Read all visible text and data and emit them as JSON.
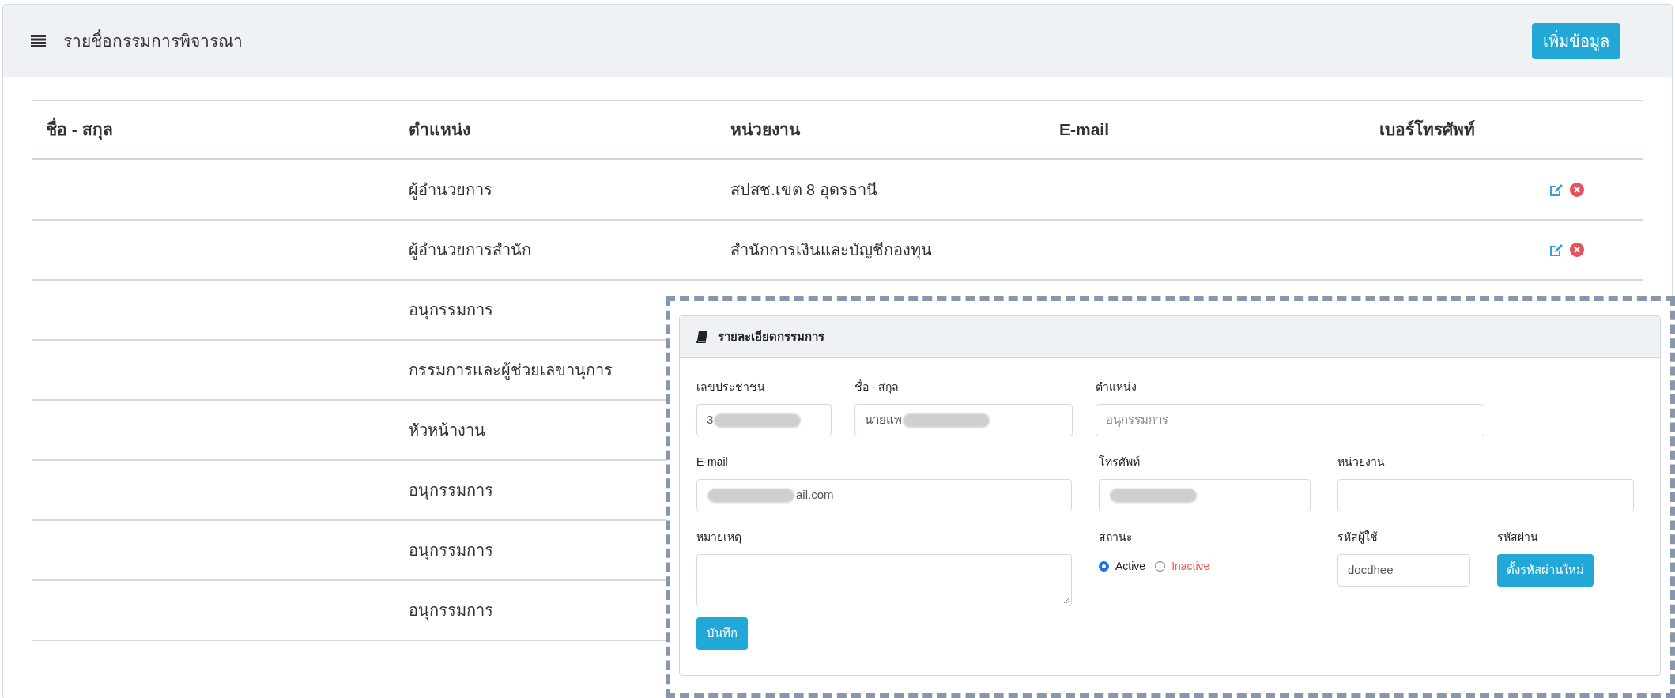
{
  "panel": {
    "title": "รายชื่อกรรมการพิจารณา",
    "add_button": "เพิ่มข้อมูล"
  },
  "table": {
    "columns": [
      "ชื่อ - สกุล",
      "ตำแหน่ง",
      "หน่วยงาน",
      "E-mail",
      "เบอร์โทรศัพท์"
    ],
    "rows": [
      {
        "position": "ผู้อำนวยการ",
        "unit": "สปสช.เขต 8 อุดรธานี",
        "actions": true
      },
      {
        "position": "ผู้อำนวยการสำนัก",
        "unit": "สำนักการเงินและบัญชีกองทุน",
        "actions": true
      },
      {
        "position": "อนุกรรมการ",
        "actions": false
      },
      {
        "position": "กรรมการและผู้ช่วยเลขานุการ",
        "actions": false
      },
      {
        "position": "หัวหน้างาน",
        "actions": false
      },
      {
        "position": "อนุกรรมการ",
        "actions": false
      },
      {
        "position": "อนุกรรมการ",
        "actions": false
      },
      {
        "position": "อนุกรรมการ",
        "actions": false
      }
    ]
  },
  "detail_card": {
    "title": "รายละเอียดกรรมการ",
    "form_rows": [
      [
        {
          "kind": "input",
          "label": "เลขประชาชน",
          "value": "3",
          "redacted": true
        },
        {
          "kind": "input",
          "label": "ชื่อ - สกุล",
          "value": "นายแพ",
          "redacted": true
        },
        {
          "kind": "input",
          "label": "ตำแหน่ง",
          "placeholder": "อนุกรรมการ",
          "redacted": false
        }
      ],
      [
        {
          "kind": "input",
          "label": "E-mail",
          "value": "ail.com",
          "redacted": true
        },
        {
          "kind": "input",
          "label": "โทรศัพท์",
          "redacted": true
        },
        {
          "kind": "input",
          "label": "หน่วยงาน",
          "redacted": false
        }
      ],
      [
        {
          "kind": "textarea",
          "label": "หมายเหตุ"
        },
        {
          "kind": "radio",
          "label": "สถานะ",
          "options": [
            {
              "label": "Active",
              "selected": true
            },
            {
              "label": "Inactive",
              "selected": false
            }
          ]
        },
        {
          "kind": "input",
          "label": "รหัสผู้ใช้",
          "value": "docdhee",
          "redacted": false
        },
        {
          "kind": "button",
          "label": "รหัสผ่าน",
          "text": "ตั้งรหัสผ่านใหม่"
        }
      ]
    ],
    "save_button": "บันทึก"
  }
}
